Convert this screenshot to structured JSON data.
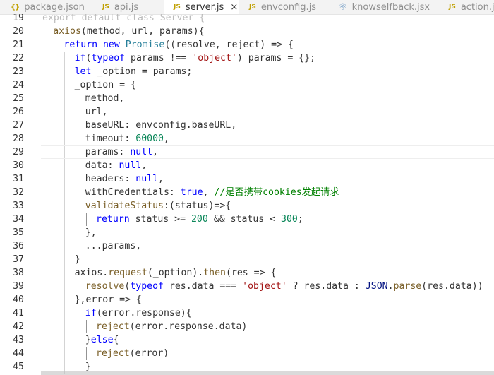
{
  "tabs": [
    {
      "icon": "{}",
      "icon_kind": "json",
      "label": "package.json",
      "active": false
    },
    {
      "icon": "JS",
      "icon_kind": "js",
      "label": "api.js",
      "active": false
    },
    {
      "icon": "JS",
      "icon_kind": "js",
      "label": "server.js",
      "active": true,
      "close": "×"
    },
    {
      "icon": "JS",
      "icon_kind": "js",
      "label": "envconfig.js",
      "active": false
    },
    {
      "icon": "⚛",
      "icon_kind": "react",
      "label": "knowselfback.jsx",
      "active": false
    },
    {
      "icon": "JS",
      "icon_kind": "js",
      "label": "action.js",
      "active": false
    }
  ],
  "colors": {
    "keyword": "#0000ff",
    "function": "#795e26",
    "string": "#a31515",
    "number": "#098658",
    "comment": "#008000",
    "variable": "#001080",
    "class": "#267f99"
  },
  "editor": {
    "current_line": 29,
    "lines": [
      {
        "n": "19",
        "indent": 0,
        "tokens": [
          [
            "ghost",
            "export default class Server {"
          ]
        ]
      },
      {
        "n": "20",
        "indent": 2,
        "tokens": [
          [
            "fn",
            "axios"
          ],
          [
            "p",
            "(method, url, params){"
          ]
        ]
      },
      {
        "n": "21",
        "indent": 4,
        "tokens": [
          [
            "kw",
            "return new "
          ],
          [
            "cls",
            "Promise"
          ],
          [
            "p",
            "((resolve, reject) => {"
          ]
        ]
      },
      {
        "n": "22",
        "indent": 6,
        "tokens": [
          [
            "kw",
            "if"
          ],
          [
            "p",
            "("
          ],
          [
            "kw",
            "typeof"
          ],
          [
            "p",
            " params !== "
          ],
          [
            "str",
            "'object'"
          ],
          [
            "p",
            ") params = {};"
          ]
        ]
      },
      {
        "n": "23",
        "indent": 6,
        "tokens": [
          [
            "kw",
            "let"
          ],
          [
            "p",
            " _option = params;"
          ]
        ]
      },
      {
        "n": "24",
        "indent": 6,
        "tokens": [
          [
            "p",
            "_option = {"
          ]
        ]
      },
      {
        "n": "25",
        "indent": 8,
        "tokens": [
          [
            "p",
            "method,"
          ]
        ]
      },
      {
        "n": "26",
        "indent": 8,
        "tokens": [
          [
            "p",
            "url,"
          ]
        ]
      },
      {
        "n": "27",
        "indent": 8,
        "tokens": [
          [
            "p",
            "baseURL: envconfig.baseURL,"
          ]
        ]
      },
      {
        "n": "28",
        "indent": 8,
        "tokens": [
          [
            "p",
            "timeout: "
          ],
          [
            "num",
            "60000"
          ],
          [
            "p",
            ","
          ]
        ]
      },
      {
        "n": "29",
        "indent": 8,
        "tokens": [
          [
            "p",
            "params: "
          ],
          [
            "kw",
            "null"
          ],
          [
            "p",
            ","
          ]
        ]
      },
      {
        "n": "30",
        "indent": 8,
        "tokens": [
          [
            "p",
            "data: "
          ],
          [
            "kw",
            "null"
          ],
          [
            "p",
            ","
          ]
        ]
      },
      {
        "n": "31",
        "indent": 8,
        "tokens": [
          [
            "p",
            "headers: "
          ],
          [
            "kw",
            "null"
          ],
          [
            "p",
            ","
          ]
        ]
      },
      {
        "n": "32",
        "indent": 8,
        "tokens": [
          [
            "p",
            "withCredentials: "
          ],
          [
            "kw",
            "true"
          ],
          [
            "p",
            ", "
          ],
          [
            "cm",
            "//是否携带cookies发起请求"
          ]
        ]
      },
      {
        "n": "33",
        "indent": 8,
        "tokens": [
          [
            "fn",
            "validateStatus"
          ],
          [
            "p",
            ":(status)=>{"
          ]
        ]
      },
      {
        "n": "34",
        "indent": 10,
        "tokens": [
          [
            "kw",
            "return"
          ],
          [
            "p",
            " status >= "
          ],
          [
            "num",
            "200"
          ],
          [
            "p",
            " && status < "
          ],
          [
            "num",
            "300"
          ],
          [
            "p",
            ";"
          ]
        ]
      },
      {
        "n": "35",
        "indent": 8,
        "tokens": [
          [
            "p",
            "},"
          ]
        ]
      },
      {
        "n": "36",
        "indent": 8,
        "tokens": [
          [
            "p",
            "...params,"
          ]
        ]
      },
      {
        "n": "37",
        "indent": 6,
        "tokens": [
          [
            "p",
            "}"
          ]
        ]
      },
      {
        "n": "38",
        "indent": 6,
        "tokens": [
          [
            "p",
            "axios."
          ],
          [
            "fn",
            "request"
          ],
          [
            "p",
            "(_option)."
          ],
          [
            "fn",
            "then"
          ],
          [
            "p",
            "(res => {"
          ]
        ]
      },
      {
        "n": "39",
        "indent": 8,
        "tokens": [
          [
            "fn",
            "resolve"
          ],
          [
            "p",
            "("
          ],
          [
            "kw",
            "typeof"
          ],
          [
            "p",
            " res.data === "
          ],
          [
            "str",
            "'object'"
          ],
          [
            "p",
            " ? res.data : "
          ],
          [
            "var",
            "JSON"
          ],
          [
            "p",
            "."
          ],
          [
            "fn",
            "parse"
          ],
          [
            "p",
            "(res.data))"
          ]
        ]
      },
      {
        "n": "40",
        "indent": 6,
        "tokens": [
          [
            "p",
            "},error => {"
          ]
        ]
      },
      {
        "n": "41",
        "indent": 8,
        "tokens": [
          [
            "kw",
            "if"
          ],
          [
            "p",
            "(error.response){"
          ]
        ]
      },
      {
        "n": "42",
        "indent": 10,
        "tokens": [
          [
            "fn",
            "reject"
          ],
          [
            "p",
            "(error.response.data)"
          ]
        ]
      },
      {
        "n": "43",
        "indent": 8,
        "tokens": [
          [
            "p",
            "}"
          ],
          [
            "kw",
            "else"
          ],
          [
            "p",
            "{"
          ]
        ]
      },
      {
        "n": "44",
        "indent": 10,
        "tokens": [
          [
            "fn",
            "reject"
          ],
          [
            "p",
            "(error)"
          ]
        ]
      },
      {
        "n": "45",
        "indent": 8,
        "tokens": [
          [
            "p",
            "}"
          ]
        ]
      }
    ]
  }
}
